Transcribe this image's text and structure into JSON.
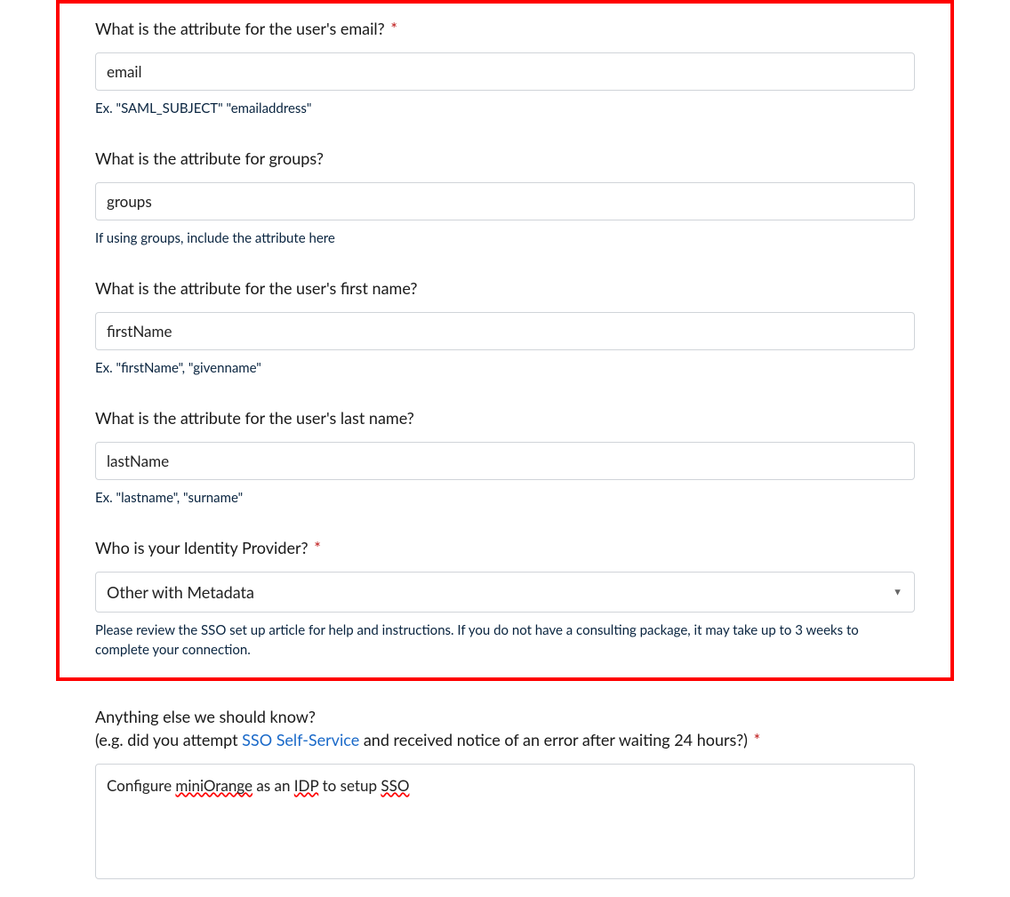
{
  "fields": {
    "email": {
      "label": "What is the attribute for the user's email?",
      "required_mark": "*",
      "value": "email",
      "helper": "Ex. \"SAML_SUBJECT\" \"emailaddress\""
    },
    "groups": {
      "label": "What is the attribute for groups?",
      "value": "groups",
      "helper": "If using groups, include the attribute here"
    },
    "firstname": {
      "label": "What is the attribute for the user's first name?",
      "value": "firstName",
      "helper": "Ex. \"firstName\", \"givenname\""
    },
    "lastname": {
      "label": "What is the attribute for the user's last name?",
      "value": "lastName",
      "helper": "Ex. \"lastname\", \"surname\""
    },
    "idp": {
      "label": "Who is your Identity Provider?",
      "required_mark": "*",
      "selected": "Other with Metadata",
      "helper": "Please review the SSO set up article for help and instructions. If you do not have a consulting package, it may take up to 3 weeks to complete your connection."
    },
    "notes": {
      "label_part1": "Anything else we should know?",
      "label_part2a": "(e.g. did you attempt ",
      "label_link": "SSO Self-Service",
      "label_part2b": " and received notice of an error after waiting 24 hours?)",
      "required_mark": "*",
      "value_parts": {
        "p1": "Configure ",
        "err1": "miniOrange",
        "p2": " as an ",
        "err2": "IDP",
        "p3": " to setup ",
        "err3": "SSO"
      }
    }
  }
}
